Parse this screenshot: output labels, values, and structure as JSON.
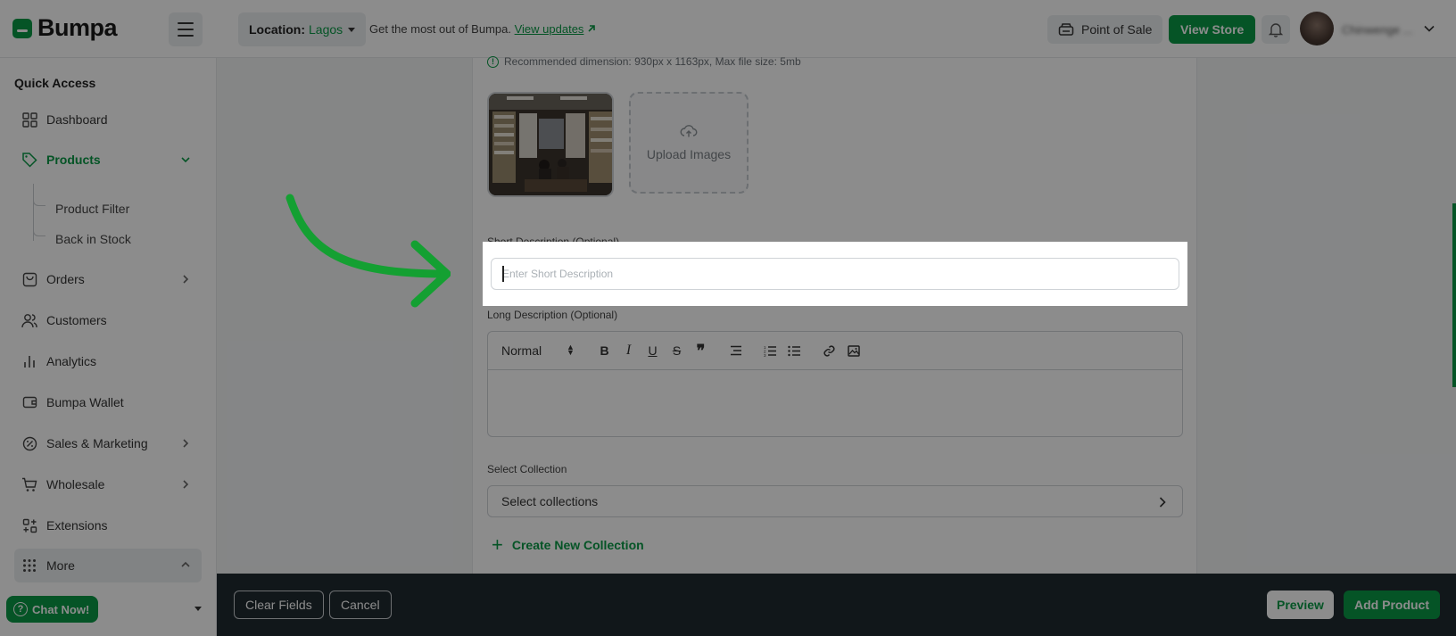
{
  "header": {
    "logo_text": "Bumpa",
    "location_label": "Location:",
    "location_value": "Lagos",
    "updates_text": "Get the most out of Bumpa.",
    "updates_link": "View updates",
    "pos_label": "Point of Sale",
    "view_store_label": "View Store",
    "user_name": "Chinwenge ..."
  },
  "sidebar": {
    "quick_access_title": "Quick Access",
    "items": [
      {
        "label": "Dashboard",
        "icon": "grid-icon"
      },
      {
        "label": "Products",
        "icon": "tag-icon"
      },
      {
        "label": "Orders",
        "icon": "bag-icon"
      },
      {
        "label": "Customers",
        "icon": "users-icon"
      },
      {
        "label": "Analytics",
        "icon": "bar-chart-icon"
      },
      {
        "label": "Bumpa Wallet",
        "icon": "wallet-icon"
      },
      {
        "label": "Sales & Marketing",
        "icon": "percent-icon"
      },
      {
        "label": "Wholesale",
        "icon": "cart-icon"
      },
      {
        "label": "Extensions",
        "icon": "extensions-icon"
      },
      {
        "label": "More",
        "icon": "dots-grid-icon"
      }
    ],
    "sub_items": [
      "Product Filter",
      "Back in Stock"
    ],
    "chat_label": "Chat Now!"
  },
  "form": {
    "dimension_hint": "Recommended dimension: 930px x 1163px, Max file size: 5mb",
    "upload_label": "Upload Images",
    "short_desc_label": "Short Description (Optional)",
    "short_desc_placeholder": "Enter Short Description",
    "short_desc_value": "",
    "long_desc_label": "Long Description (Optional)",
    "editor_format": "Normal",
    "collection_label": "Select Collection",
    "collection_placeholder": "Select collections",
    "create_collection_label": "Create New Collection"
  },
  "actions": {
    "clear_label": "Clear Fields",
    "cancel_label": "Cancel",
    "preview_label": "Preview",
    "add_label": "Add Product"
  },
  "colors": {
    "brand_green": "#0a9a46",
    "bottom_bar": "#1f2a30",
    "overlay": "rgba(0,0,0,0.45)"
  }
}
